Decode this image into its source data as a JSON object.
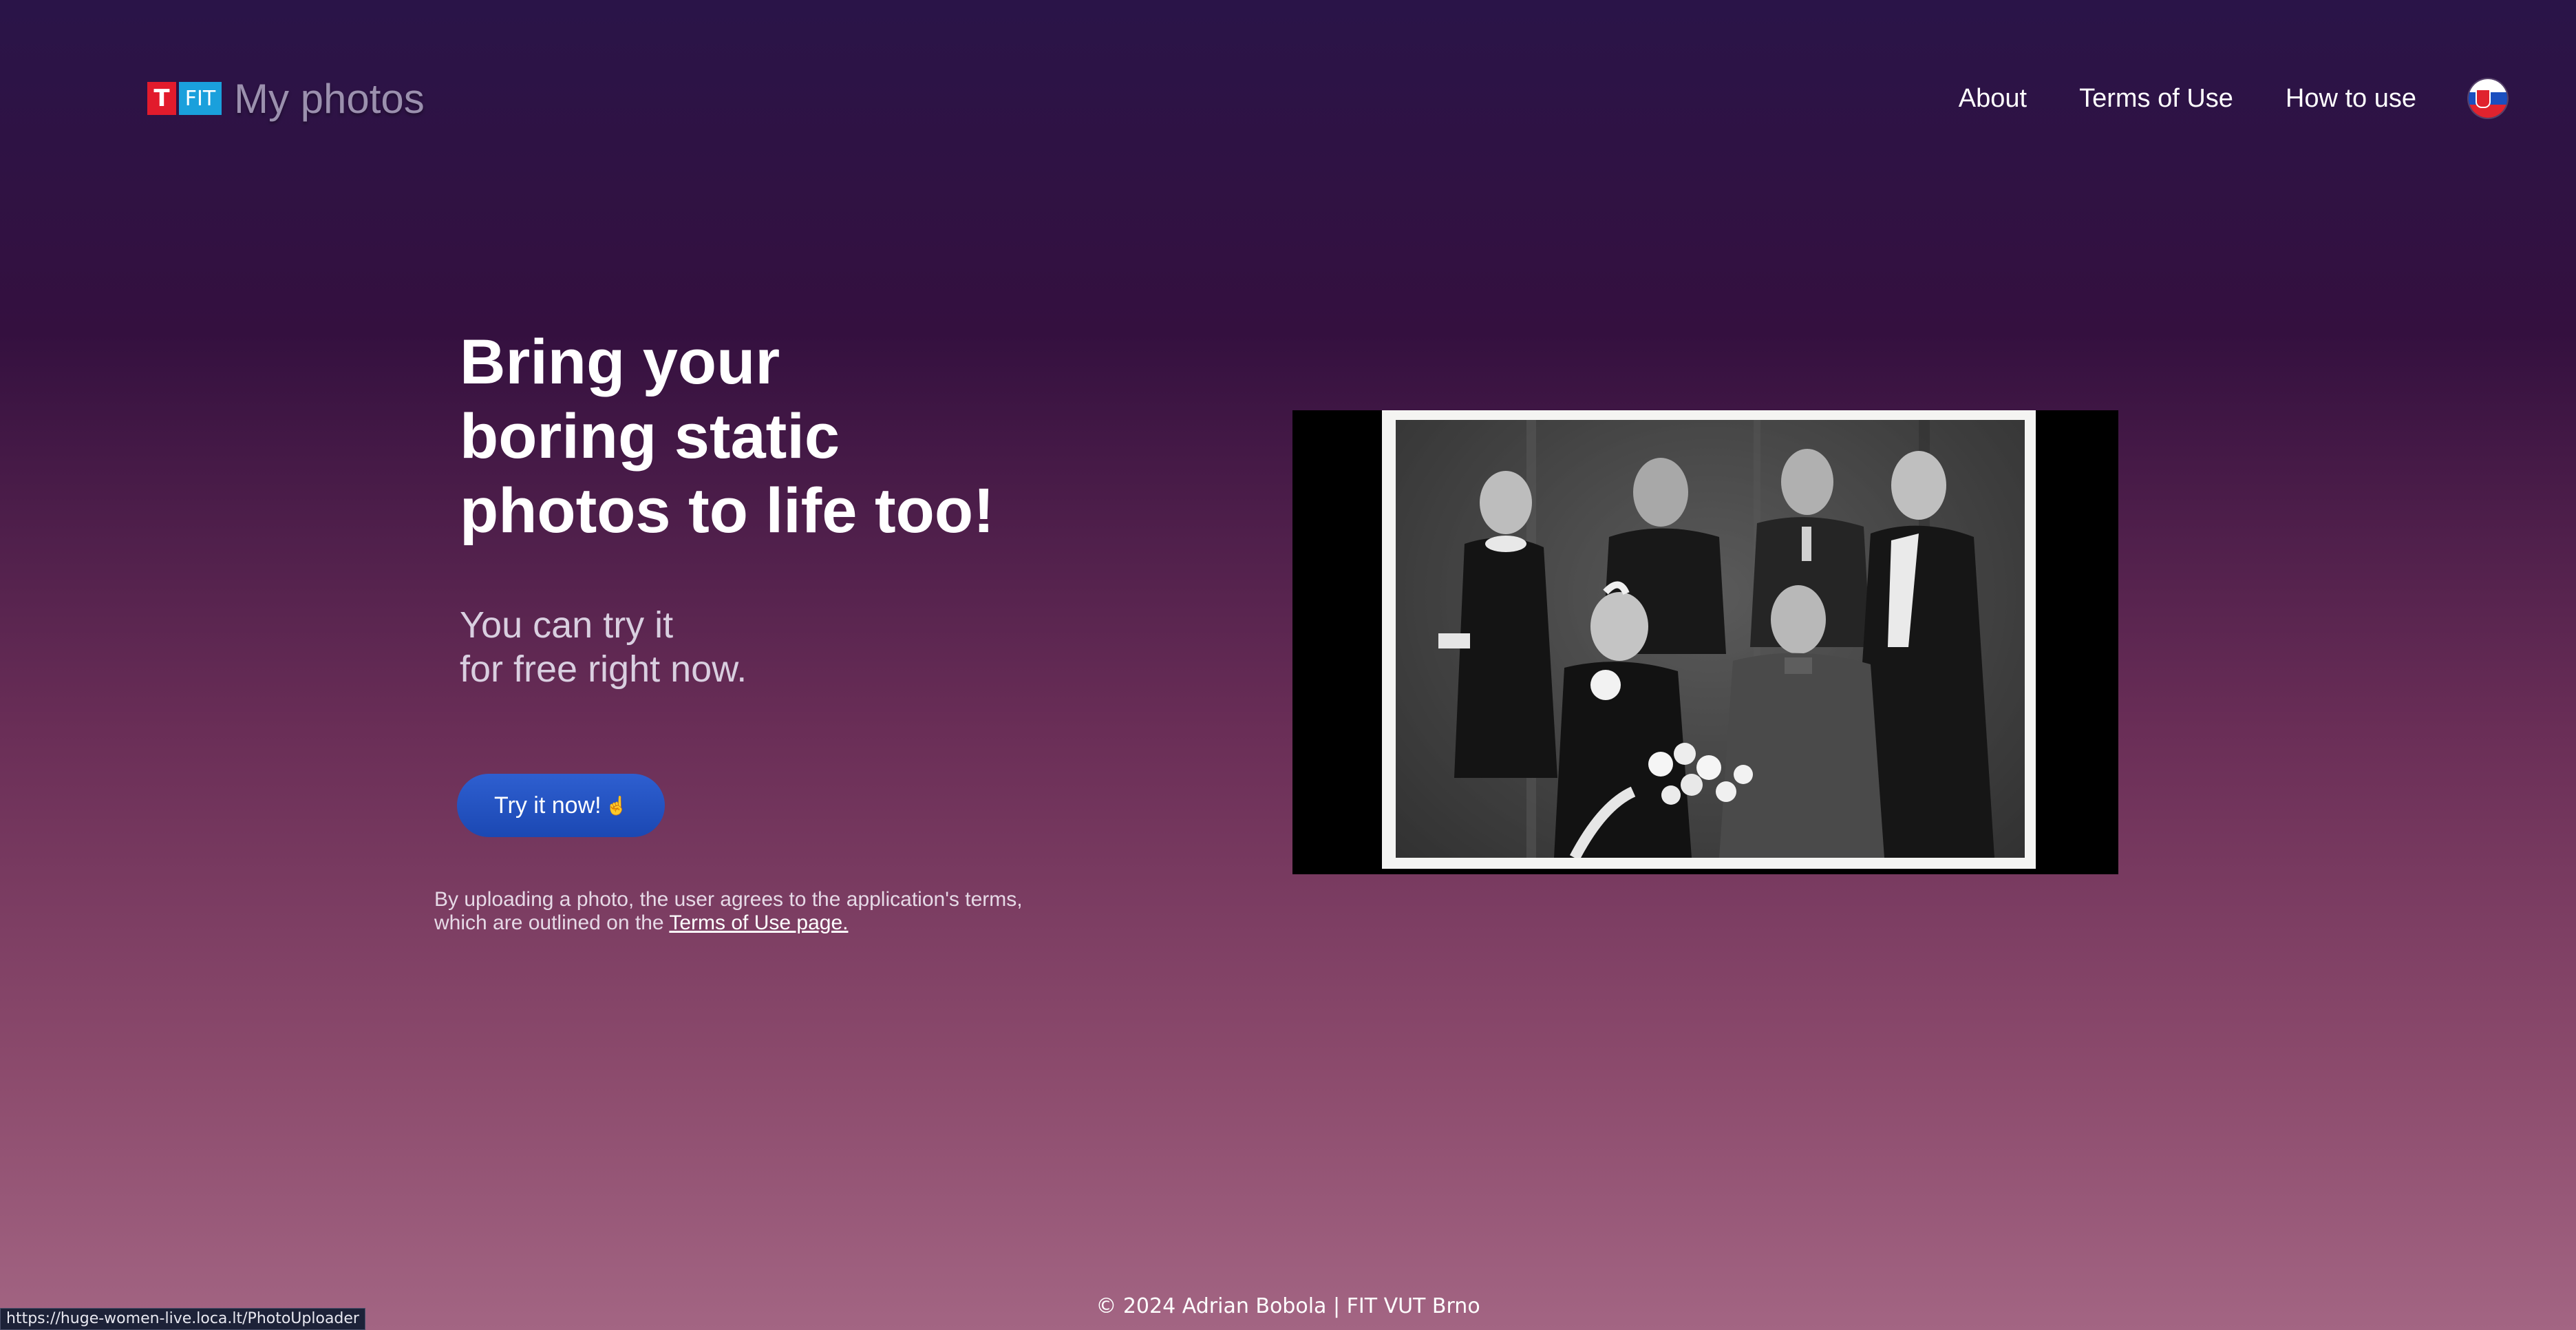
{
  "header": {
    "logo": {
      "t_label": "T",
      "fit_label": "FIT"
    },
    "title": "My photos",
    "nav": {
      "about": "About",
      "terms": "Terms of Use",
      "how_to": "How to use"
    },
    "language_icon": "slovak-flag-icon"
  },
  "hero": {
    "title_lines": [
      "Bring your",
      "boring static",
      "photos to life too!"
    ],
    "subtitle_lines": [
      "You can try it",
      "for free right now."
    ],
    "cta_label": "Try it now!",
    "cta_icon": "pointer-hand-icon",
    "terms_line1": "By uploading a photo, the user agrees to the application's terms,",
    "terms_line2_prefix": "which are outlined on the",
    "terms_link": "Terms of Use page."
  },
  "image": {
    "description_icon": "family-portrait-photo"
  },
  "footer": {
    "text": "© 2024 Adrian Bobola | FIT VUT Brno"
  },
  "status_bar": {
    "url": "https://huge-women-live.loca.lt/PhotoUploader"
  },
  "colors": {
    "background_top": "#2a1448",
    "background_bottom": "#a36583",
    "cta": "#2450c2",
    "logo_red": "#e21b2c",
    "logo_blue": "#1aa0dc"
  }
}
